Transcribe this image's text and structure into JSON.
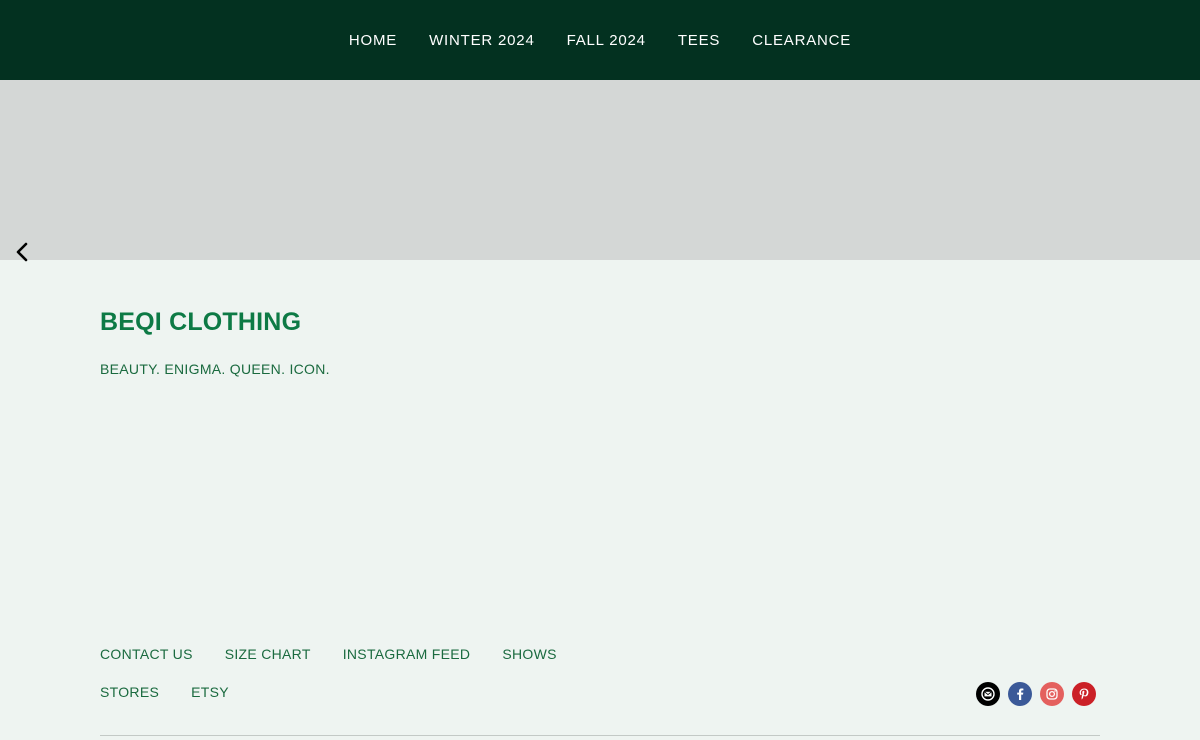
{
  "nav": {
    "items": [
      {
        "label": "HOME"
      },
      {
        "label": "WINTER 2024"
      },
      {
        "label": "FALL 2024"
      },
      {
        "label": "TEES"
      },
      {
        "label": "CLEARANCE"
      }
    ]
  },
  "hero": {
    "prev_icon": "chevron-left-icon"
  },
  "brand": {
    "title": "BEQI CLOTHING",
    "tagline": "BEAUTY. ENIGMA. QUEEN. ICON."
  },
  "footer": {
    "row1": [
      {
        "label": "CONTACT US"
      },
      {
        "label": "SIZE CHART"
      },
      {
        "label": "INSTAGRAM FEED"
      },
      {
        "label": "SHOWS"
      }
    ],
    "row2": [
      {
        "label": "STORES"
      },
      {
        "label": "ETSY"
      }
    ],
    "social": [
      {
        "icon": "email-icon",
        "color": "#000000"
      },
      {
        "icon": "facebook-icon",
        "color": "#3b5998"
      },
      {
        "icon": "instagram-icon",
        "color": "#e4605e"
      },
      {
        "icon": "pinterest-icon",
        "color": "#cb2027"
      }
    ]
  },
  "colors": {
    "nav_bg": "#033120",
    "hero_bg": "#d4d7d6",
    "page_bg": "#eef4f1",
    "brand_green": "#0d7a45",
    "link_green": "#1a6a3f"
  }
}
